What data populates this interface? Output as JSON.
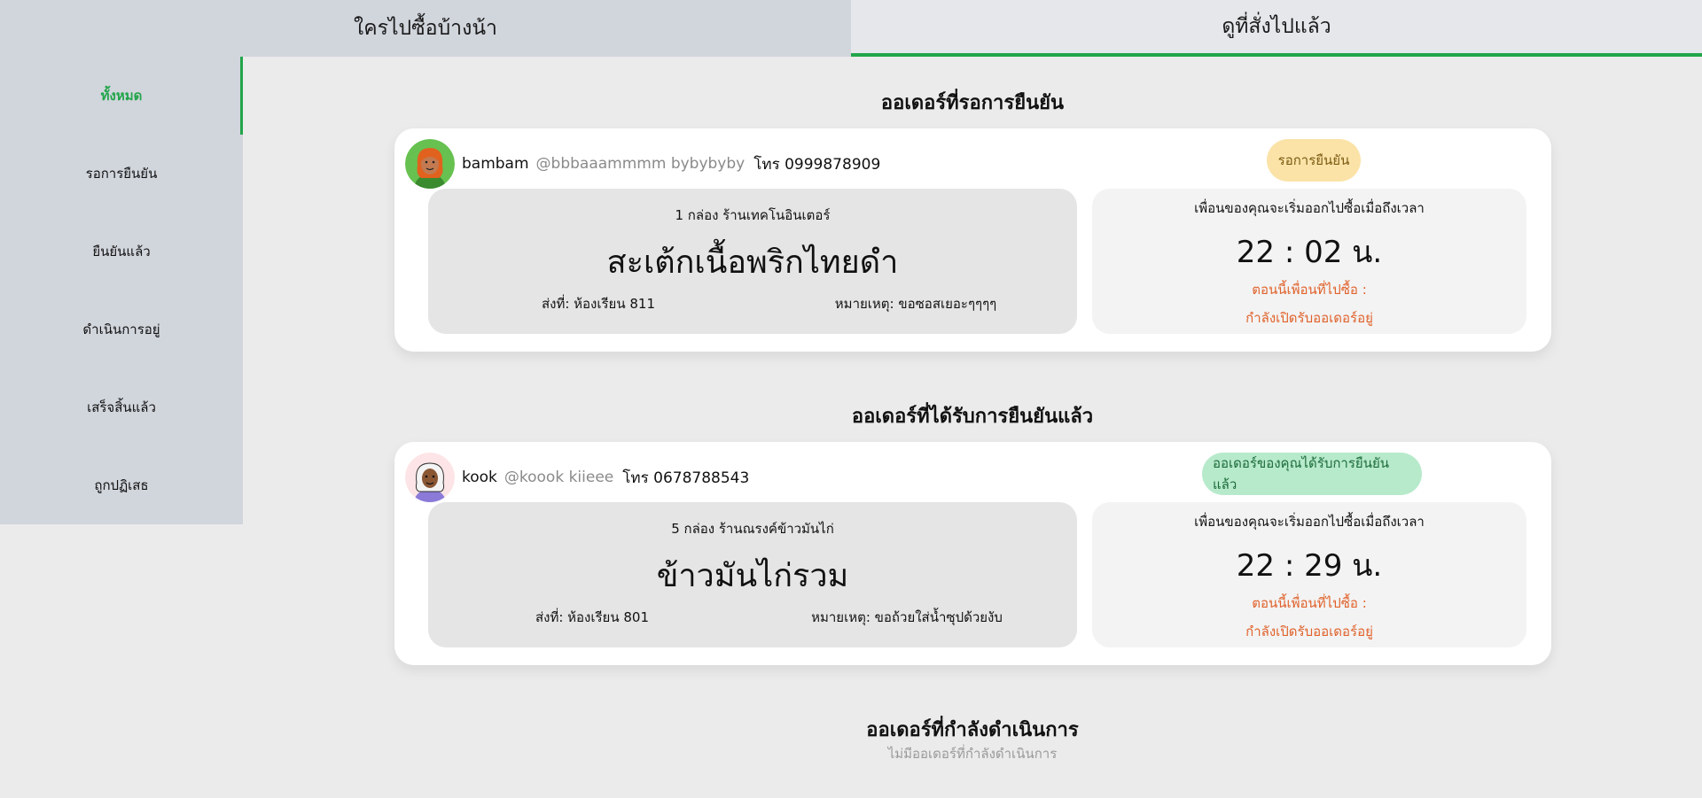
{
  "tabs": {
    "left_label": "ใครไปซื้อบ้างน้า",
    "right_label": "ดูที่สั่งไปแล้ว"
  },
  "sidebar": {
    "items": [
      {
        "label": "ทั้งหมด",
        "active": true
      },
      {
        "label": "รอการยืนยัน",
        "active": false
      },
      {
        "label": "ยืนยันแล้ว",
        "active": false
      },
      {
        "label": "ดำเนินการอยู่",
        "active": false
      },
      {
        "label": "เสร็จสิ้นแล้ว",
        "active": false
      },
      {
        "label": "ถูกปฏิเสธ",
        "active": false
      }
    ]
  },
  "sections": {
    "pending_title": "ออเดอร์ที่รอการยืนยัน",
    "confirmed_title": "ออเดอร์ที่ได้รับการยืนยันแล้ว",
    "in_progress_title": "ออเดอร์ที่กำลังดำเนินการ",
    "in_progress_empty": "ไม่มีออเดอร์ที่กำลังดำเนินการ"
  },
  "orders": [
    {
      "username": "bambam",
      "handle": "@bbbaaammmm bybybyby",
      "phone": "โทร 0999878909",
      "badge": "รอการยืนยัน",
      "shop_line": "1 กล่อง ร้านเทคโนอินเตอร์",
      "item_name": "สะเต้กเนื้อพริกไทยดำ",
      "destination": "ส่งที่: ห้องเรียน 811",
      "note": "หมายเหตุ: ขอซอสเยอะๆๆๆๆ",
      "time_label": "เพื่อนของคุณจะเริ่มออกไปซื้อเมื่อถึงเวลา",
      "time": "22 : 02 น.",
      "buyer_label": "ตอนนี้เพื่อนที่ไปซื้อ :",
      "buyer_status": "กำลังเปิดรับออเดอร์อยู่"
    },
    {
      "username": "kook",
      "handle": "@koook kiieee",
      "phone": "โทร 0678788543",
      "badge": "ออเดอร์ของคุณได้รับการยืนยันแล้ว",
      "shop_line": "5 กล่อง ร้านณรงค์ข้าวมันไก่",
      "item_name": "ข้าวมันไก่รวม",
      "destination": "ส่งที่: ห้องเรียน 801",
      "note": "หมายเหตุ: ขอถ้วยใส่น้ำซุปด้วยงับ",
      "time_label": "เพื่อนของคุณจะเริ่มออกไปซื้อเมื่อถึงเวลา",
      "time": "22 : 29 น.",
      "buyer_label": "ตอนนี้เพื่อนที่ไปซื้อ :",
      "buyer_status": "กำลังเปิดรับออเดอร์อยู่"
    }
  ],
  "colors": {
    "accent": "#22a54a",
    "pending_badge": "#fbe3a8",
    "confirmed_badge": "#b7eacb",
    "buyer_text": "#e0622b"
  }
}
